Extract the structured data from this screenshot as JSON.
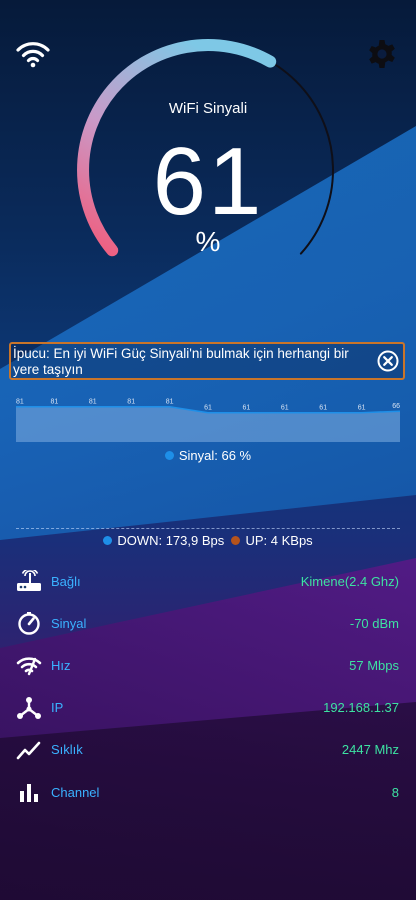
{
  "gauge": {
    "title": "WiFi Sinyali",
    "value": "61",
    "unit": "%",
    "level": 0.61
  },
  "tip": {
    "text": "İpucu: En iyi WiFi Güç Sinyali'ni bulmak için herhangi bir yere taşıyın"
  },
  "signal_graph": {
    "labels": [
      "81",
      "81",
      "81",
      "81",
      "81",
      "61",
      "61",
      "61",
      "61",
      "61",
      "66"
    ],
    "values": [
      81,
      81,
      81,
      81,
      81,
      61,
      61,
      61,
      61,
      61,
      66
    ],
    "legend": "Sinyal: 66 %",
    "color": "#1e8fe8"
  },
  "speed": {
    "down_label": "DOWN: 173,9 Bps",
    "up_label": "UP: 4 KBps",
    "down_color": "#1e8fe8",
    "up_color": "#b5531c"
  },
  "info_rows": [
    {
      "icon": "router-icon",
      "label": "Bağlı",
      "value": "Kimene(2.4 Ghz)"
    },
    {
      "icon": "speedometer-icon",
      "label": "Sinyal",
      "value": "-70 dBm"
    },
    {
      "icon": "wifi-speed-icon",
      "label": "Hız",
      "value": "57 Mbps"
    },
    {
      "icon": "network-icon",
      "label": "IP",
      "value": "192.168.1.37"
    },
    {
      "icon": "frequency-icon",
      "label": "Sıklık",
      "value": "2447 Mhz"
    },
    {
      "icon": "bar-chart-icon",
      "label": "Channel",
      "value": "8"
    }
  ],
  "colors": {
    "label": "#3ab2ff",
    "value": "#3de2a2",
    "tip_border": "#c9752a"
  }
}
